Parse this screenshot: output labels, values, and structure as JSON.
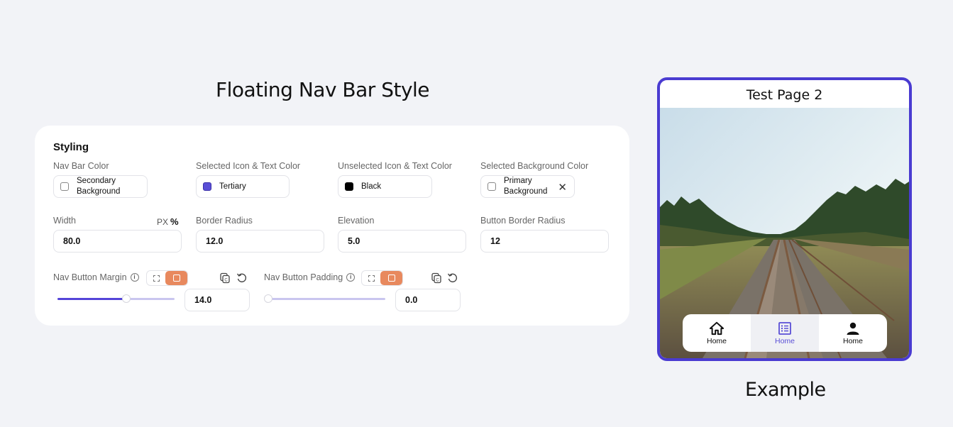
{
  "page": {
    "title": "Floating Nav Bar Style",
    "example_caption": "Example"
  },
  "styling": {
    "heading": "Styling",
    "colors": [
      {
        "label": "Nav Bar Color",
        "value": "Secondary\nBackground",
        "swatch": "#ffffff"
      },
      {
        "label": "Selected Icon & Text Color",
        "value": "Tertiary",
        "swatch": "#5a4fd6"
      },
      {
        "label": "Unselected Icon & Text Color",
        "value": "Black",
        "swatch": "#000000"
      },
      {
        "label": "Selected Background Color",
        "value": "Primary\nBackground",
        "swatch": "#ffffff",
        "clear": "✕"
      }
    ],
    "width": {
      "label": "Width",
      "unit_px": "PX",
      "unit_pct": "%",
      "value": "80.0"
    },
    "border_radius": {
      "label": "Border Radius",
      "value": "12.0"
    },
    "elevation": {
      "label": "Elevation",
      "value": "5.0"
    },
    "button_border_radius": {
      "label": "Button Border Radius",
      "value": "12"
    },
    "nav_button_margin": {
      "label": "Nav Button Margin",
      "info": "i",
      "value": "14.0",
      "slider_fraction": 0.59
    },
    "nav_button_padding": {
      "label": "Nav Button Padding",
      "info": "i",
      "value": "0.0",
      "slider_fraction": 0.0
    }
  },
  "preview": {
    "title": "Test Page 2",
    "nav_items": [
      {
        "label": "Home",
        "icon": "home-icon",
        "selected": false
      },
      {
        "label": "Home",
        "icon": "list-icon",
        "selected": true
      },
      {
        "label": "Home",
        "icon": "person-icon",
        "selected": false
      }
    ]
  },
  "colors": {
    "accent": "#5544d8",
    "segment_active": "#e8895e",
    "frame": "#4a3bd1"
  }
}
